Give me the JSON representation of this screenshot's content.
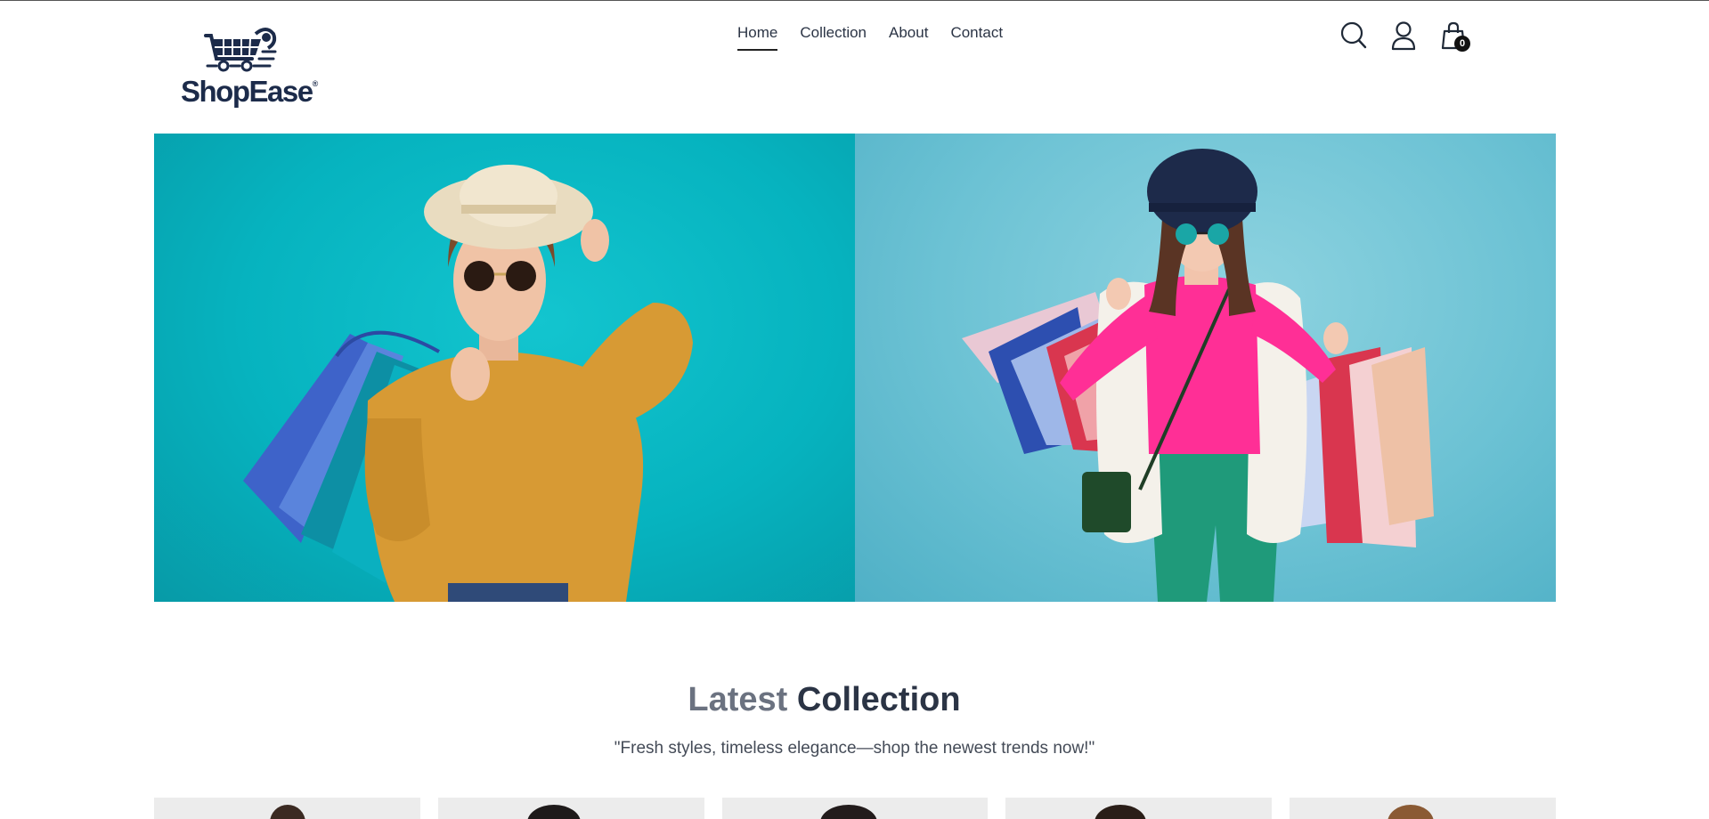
{
  "brand": {
    "name": "ShopEase",
    "registered_mark": "®"
  },
  "nav": {
    "items": [
      {
        "label": "Home",
        "active": true
      },
      {
        "label": "Collection",
        "active": false
      },
      {
        "label": "About",
        "active": false
      },
      {
        "label": "Contact",
        "active": false
      }
    ]
  },
  "header_icons": {
    "search": "search-icon",
    "account": "user-icon",
    "cart": "shopping-bag-icon",
    "cart_count": "0"
  },
  "hero": {
    "panels": [
      {
        "image": "woman-yellow-sweater-with-shopping-bags",
        "background": "#08b6c2"
      },
      {
        "image": "woman-pink-top-with-shopping-bags",
        "background": "#6cc2d4"
      }
    ]
  },
  "latest": {
    "title_light": "Latest",
    "title_bold": "Collection",
    "subtitle": "\"Fresh styles, timeless elegance—shop the newest trends now!\""
  },
  "product_cards": [
    {
      "image": "product-photo"
    },
    {
      "image": "product-photo"
    },
    {
      "image": "product-photo"
    },
    {
      "image": "product-photo"
    },
    {
      "image": "product-photo"
    }
  ],
  "colors": {
    "brand_navy": "#1c2b4a",
    "text_dark": "#2b3445",
    "text_muted": "#6b7280"
  }
}
